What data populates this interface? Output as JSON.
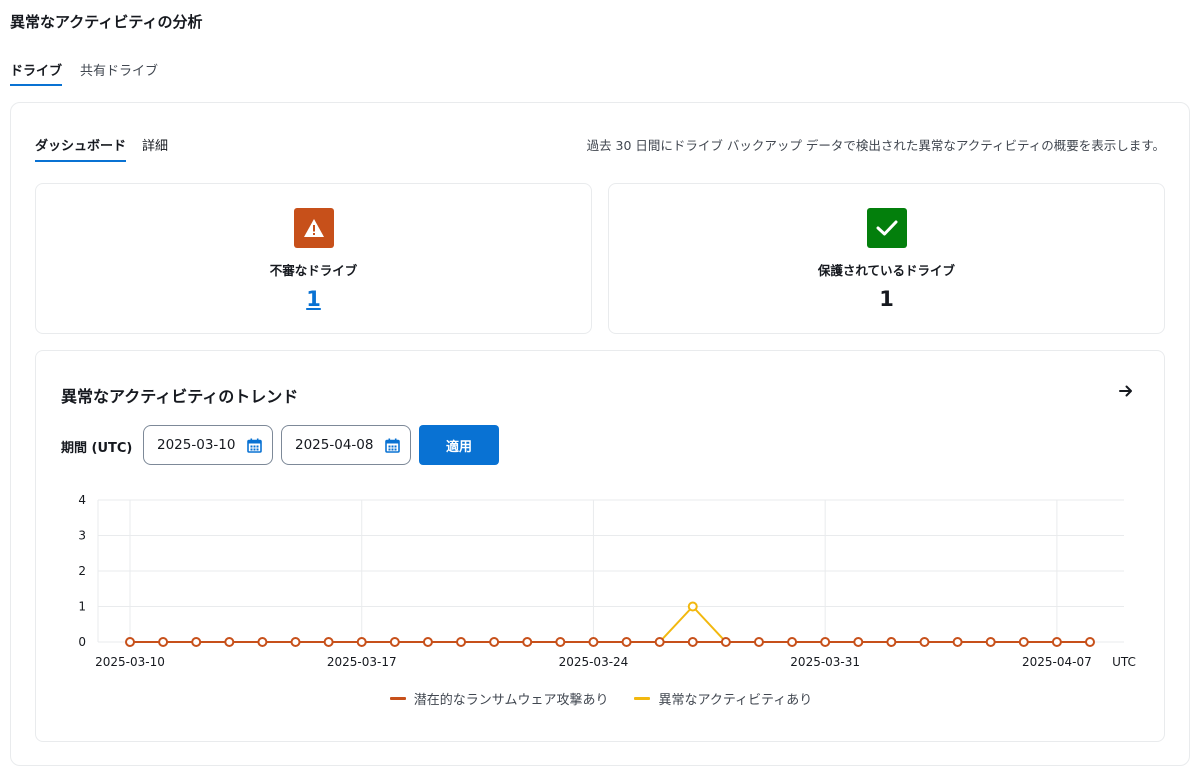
{
  "page": {
    "title": "異常なアクティビティの分析"
  },
  "tabs": [
    {
      "label": "ドライブ",
      "active": true
    },
    {
      "label": "共有ドライブ",
      "active": false
    }
  ],
  "subtabs": [
    {
      "label": "ダッシュボード",
      "active": true
    },
    {
      "label": "詳細",
      "active": false
    }
  ],
  "summary": "過去 30 日間にドライブ バックアップ データで検出された異常なアクティビティの概要を表示します。",
  "cards": {
    "suspicious": {
      "label": "不審なドライブ",
      "value": "1",
      "icon": "warning-icon",
      "color": "#c7501a"
    },
    "protected": {
      "label": "保護されているドライブ",
      "value": "1",
      "icon": "check-icon",
      "color": "#037f0c"
    }
  },
  "trend": {
    "title": "異常なアクティビティのトレンド",
    "period_label": "期間 (UTC)",
    "start_date": "2025-03-10",
    "end_date": "2025-04-08",
    "apply_label": "適用"
  },
  "chart_data": {
    "type": "line",
    "x": [
      "2025-03-10",
      "2025-03-11",
      "2025-03-12",
      "2025-03-13",
      "2025-03-14",
      "2025-03-15",
      "2025-03-16",
      "2025-03-17",
      "2025-03-18",
      "2025-03-19",
      "2025-03-20",
      "2025-03-21",
      "2025-03-22",
      "2025-03-23",
      "2025-03-24",
      "2025-03-25",
      "2025-03-26",
      "2025-03-27",
      "2025-03-28",
      "2025-03-29",
      "2025-03-30",
      "2025-03-31",
      "2025-04-01",
      "2025-04-02",
      "2025-04-03",
      "2025-04-04",
      "2025-04-05",
      "2025-04-06",
      "2025-04-07",
      "2025-04-08"
    ],
    "x_ticks": [
      "2025-03-10",
      "2025-03-17",
      "2025-03-24",
      "2025-03-31",
      "2025-04-07"
    ],
    "x_unit": "UTC",
    "y_ticks": [
      0,
      1,
      2,
      3,
      4
    ],
    "ylim": [
      0,
      4
    ],
    "series": [
      {
        "name": "潜在的なランサムウェア攻撃あり",
        "color": "#c7501a",
        "values": [
          0,
          0,
          0,
          0,
          0,
          0,
          0,
          0,
          0,
          0,
          0,
          0,
          0,
          0,
          0,
          0,
          0,
          0,
          0,
          0,
          0,
          0,
          0,
          0,
          0,
          0,
          0,
          0,
          0,
          0
        ]
      },
      {
        "name": "異常なアクティビティあり",
        "color": "#f2b80f",
        "values": [
          0,
          0,
          0,
          0,
          0,
          0,
          0,
          0,
          0,
          0,
          0,
          0,
          0,
          0,
          0,
          0,
          0,
          1,
          0,
          0,
          0,
          0,
          0,
          0,
          0,
          0,
          0,
          0,
          0,
          0
        ]
      }
    ],
    "grid": true,
    "legend": "bottom-center"
  }
}
